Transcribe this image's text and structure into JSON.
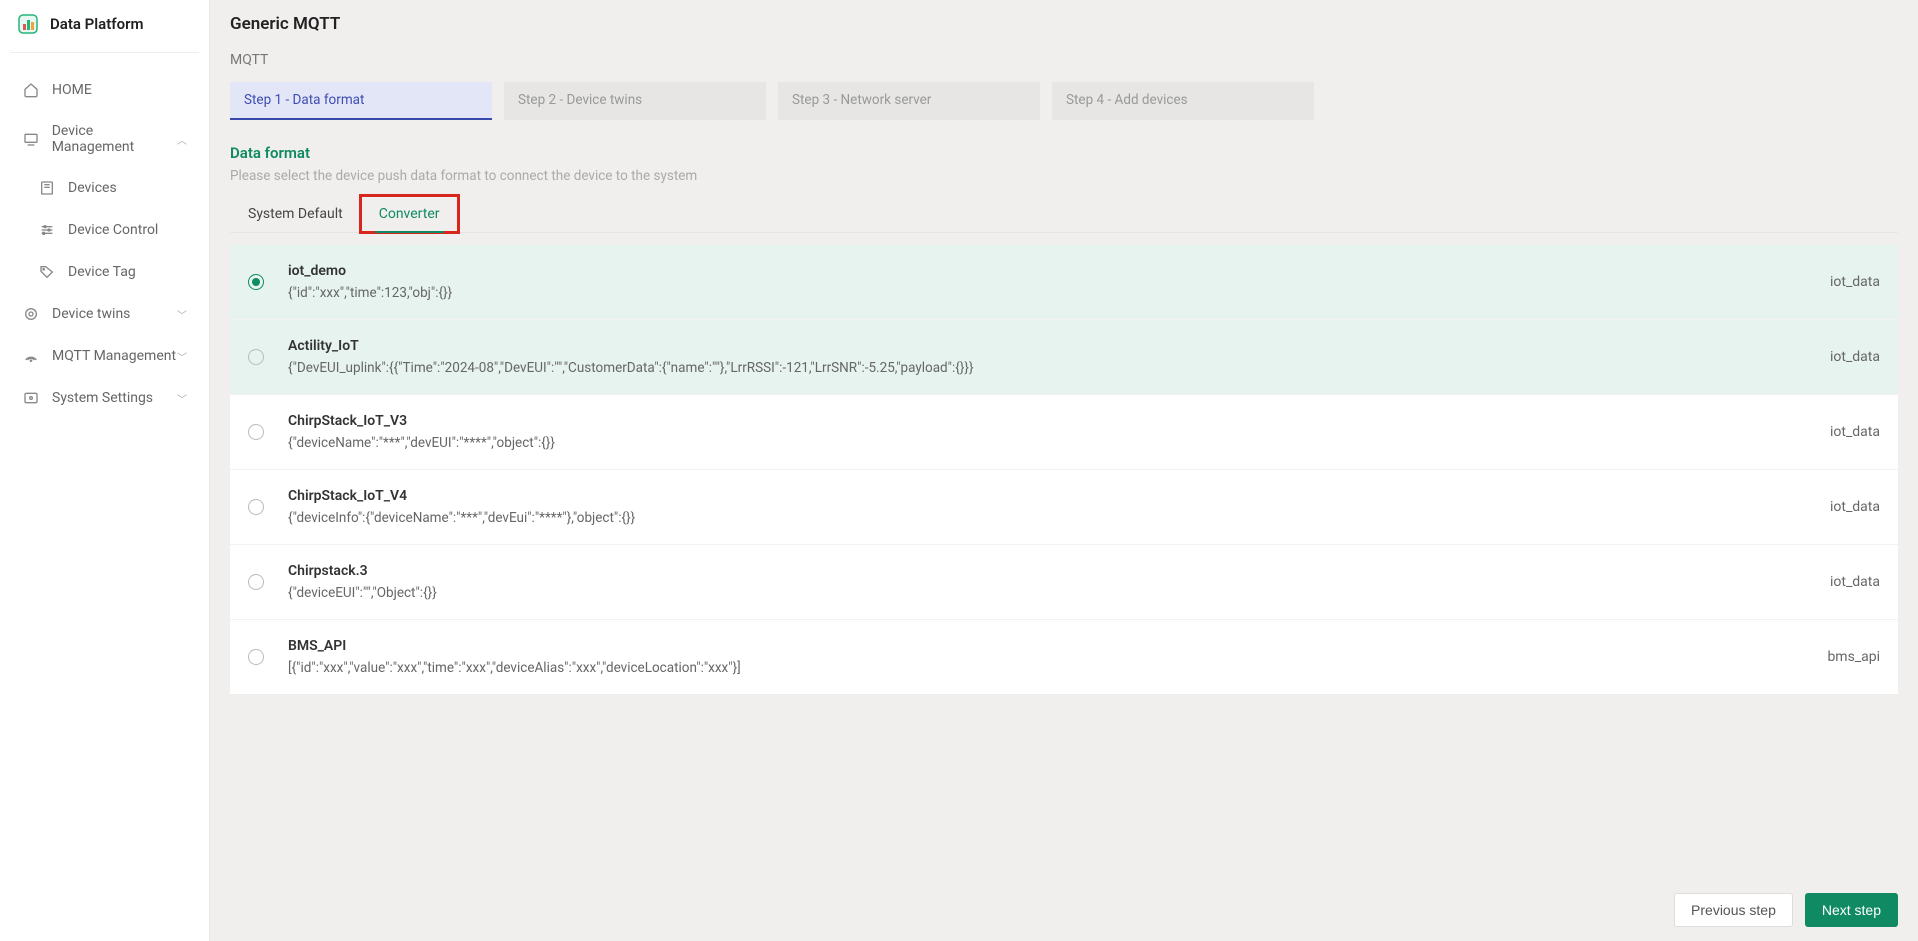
{
  "brand": "Data Platform",
  "sidebar": {
    "items": [
      {
        "label": "HOME",
        "icon": "home",
        "children": null,
        "expanded": false
      },
      {
        "label": "Device Management",
        "icon": "devices",
        "expanded": true,
        "children": [
          {
            "label": "Devices",
            "icon": "device"
          },
          {
            "label": "Device Control",
            "icon": "control"
          },
          {
            "label": "Device Tag",
            "icon": "tag"
          }
        ]
      },
      {
        "label": "Device twins",
        "icon": "twins",
        "expanded": false,
        "children": []
      },
      {
        "label": "MQTT Management",
        "icon": "mqtt",
        "expanded": false,
        "children": []
      },
      {
        "label": "System Settings",
        "icon": "settings",
        "expanded": false,
        "children": []
      }
    ]
  },
  "page": {
    "title": "Generic MQTT",
    "breadcrumb": "MQTT",
    "steps": [
      {
        "label": "Step 1 - Data format",
        "active": true
      },
      {
        "label": "Step 2 - Device twins",
        "active": false
      },
      {
        "label": "Step 3 - Network server",
        "active": false
      },
      {
        "label": "Step 4 - Add devices",
        "active": false
      }
    ],
    "section_title": "Data format",
    "section_sub": "Please select the device push data format to connect the device to the system",
    "tabs": [
      {
        "label": "System Default",
        "active": false,
        "highlight": false
      },
      {
        "label": "Converter",
        "active": true,
        "highlight": true
      }
    ],
    "options": [
      {
        "name": "iot_demo",
        "desc": "{\"id\":\"xxx\",\"time\":123,\"obj\":{}}",
        "tag": "iot_data",
        "selected": true,
        "tinted": true
      },
      {
        "name": "Actility_IoT",
        "desc": "{\"DevEUI_uplink\":{{\"Time\":\"2024-08\",\"DevEUI\":\"\",\"CustomerData\":{\"name\":\"\"},\"LrrRSSI\":-121,\"LrrSNR\":-5.25,\"payload\":{}}}",
        "tag": "iot_data",
        "selected": false,
        "tinted": true
      },
      {
        "name": "ChirpStack_IoT_V3",
        "desc": "{\"deviceName\":\"***\",\"devEUI\":\"****\",\"object\":{}}",
        "tag": "iot_data",
        "selected": false,
        "tinted": false
      },
      {
        "name": "ChirpStack_IoT_V4",
        "desc": "{\"deviceInfo\":{\"deviceName\":\"***\",\"devEui\":\"****\"},\"object\":{}}",
        "tag": "iot_data",
        "selected": false,
        "tinted": false
      },
      {
        "name": "Chirpstack.3",
        "desc": "{\"deviceEUI\":\"\",\"Object\":{}}",
        "tag": "iot_data",
        "selected": false,
        "tinted": false
      },
      {
        "name": "BMS_API",
        "desc": "[{\"id\":\"xxx\",\"value\":\"xxx\",\"time\":\"xxx\",\"deviceAlias\":\"xxx\",\"deviceLocation\":\"xxx\"}]",
        "tag": "bms_api",
        "selected": false,
        "tinted": false
      }
    ],
    "buttons": {
      "previous": "Previous step",
      "next": "Next step"
    }
  }
}
